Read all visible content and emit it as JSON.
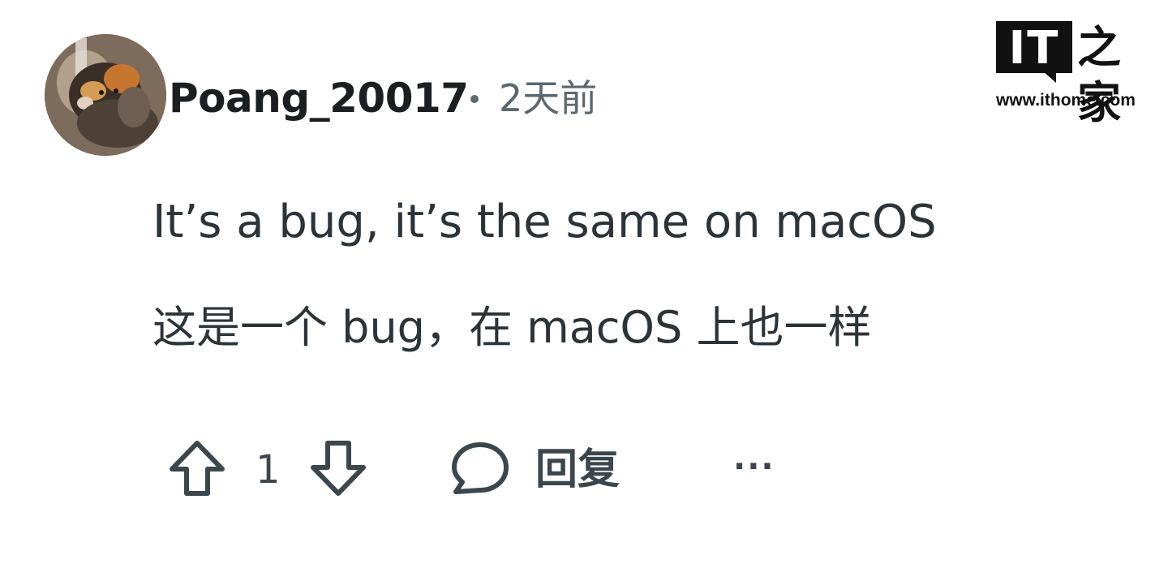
{
  "comment": {
    "username": "Poang_20017",
    "separator": "•",
    "timestamp": "2天前",
    "body_en": "It’s a bug, it’s the same on macOS",
    "body_zh": "这是一个 bug，在 macOS 上也一样"
  },
  "actions": {
    "upvote_icon": "arrow-up-icon",
    "vote_count": "1",
    "downvote_icon": "arrow-down-icon",
    "reply_icon": "speech-bubble-icon",
    "reply_label": "回复",
    "more_label": "···"
  },
  "watermark": {
    "logo_it": "IT",
    "logo_zhi": "之家",
    "url": "www.ithome.com"
  },
  "colors": {
    "text": "#2c3439",
    "meta": "#5c6870",
    "username": "#1c1f22",
    "background": "#ffffff"
  }
}
